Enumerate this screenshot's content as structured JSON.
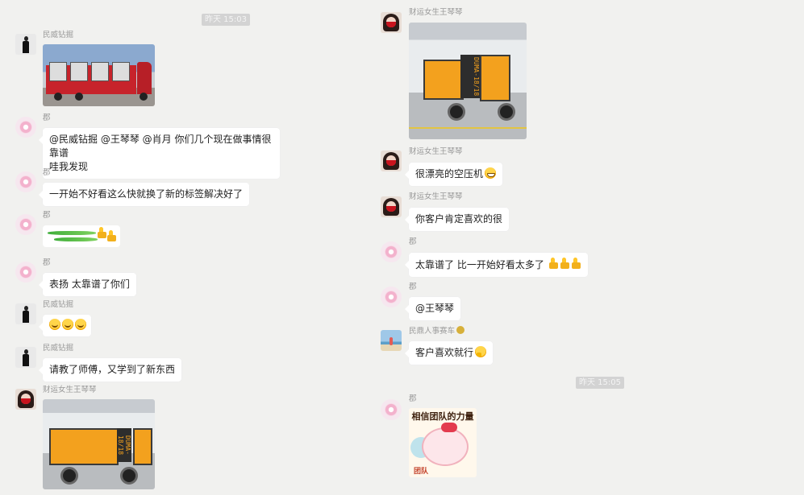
{
  "left": {
    "timestamp": "昨天 15:03",
    "messages": [
      {
        "sender": "民威钻掘",
        "avatar": "woman-silhouette",
        "type": "image",
        "image": "red-truck-cargo"
      },
      {
        "sender": "郡",
        "avatar": "pink-flower",
        "type": "text",
        "lines": [
          "@民威钻掘 @王琴琴 @肖月 你们几个现在做事情很靠谱",
          "哇我发现"
        ]
      },
      {
        "sender": "郡",
        "avatar": "pink-flower",
        "type": "text",
        "text": "一开始不好看这么快就换了新的标签解决好了"
      },
      {
        "sender": "郡",
        "avatar": "pink-flower",
        "type": "sticker",
        "sticker": "green-grass-thumbs"
      },
      {
        "sender": "郡",
        "avatar": "pink-flower",
        "type": "text",
        "text": "表扬 太靠谱了你们"
      },
      {
        "sender": "民威钻掘",
        "avatar": "woman-silhouette",
        "type": "emoji",
        "emoji": [
          "smile",
          "smile",
          "smile"
        ]
      },
      {
        "sender": "民威钻掘",
        "avatar": "woman-silhouette",
        "type": "text",
        "text": "请教了师傅，又学到了新东西"
      },
      {
        "sender": "财运女生王琴琴",
        "avatar": "masked-woman",
        "type": "image",
        "image": "orange-compressor-wide"
      }
    ]
  },
  "right": {
    "timestamp": "昨天 15:05",
    "messages": [
      {
        "sender": "财运女生王琴琴",
        "avatar": "masked-woman",
        "type": "image",
        "image": "orange-compressor"
      },
      {
        "sender": "财运女生王琴琴",
        "avatar": "masked-woman",
        "type": "text",
        "text": "很漂亮的空压机",
        "emoji": "grin"
      },
      {
        "sender": "财运女生王琴琴",
        "avatar": "masked-woman",
        "type": "text",
        "text": "你客户肯定喜欢的很"
      },
      {
        "sender": "郡",
        "avatar": "pink-flower",
        "type": "text",
        "text": "太靠谱了  比一开始好看太多了",
        "emoji": [
          "thumbs-up",
          "thumbs-up",
          "thumbs-up"
        ]
      },
      {
        "sender": "郡",
        "avatar": "pink-flower",
        "type": "text",
        "text": "@王琴琴"
      },
      {
        "sender": "民鼎人事赛车",
        "avatar": "beach",
        "type": "text",
        "text": "客户喜欢就行",
        "emoji": "think",
        "sender_badge": "badge"
      },
      {
        "sender": "郡",
        "avatar": "pink-flower",
        "type": "sticker",
        "sticker": "team-power",
        "sticker_text": "相信团队的力量",
        "sticker_tag": "团队"
      }
    ]
  },
  "colors": {
    "background": "#f1f1ef",
    "bubble": "#ffffff",
    "sender_text": "#9a9a9a",
    "timestamp_bg": "#d3d3d3"
  }
}
